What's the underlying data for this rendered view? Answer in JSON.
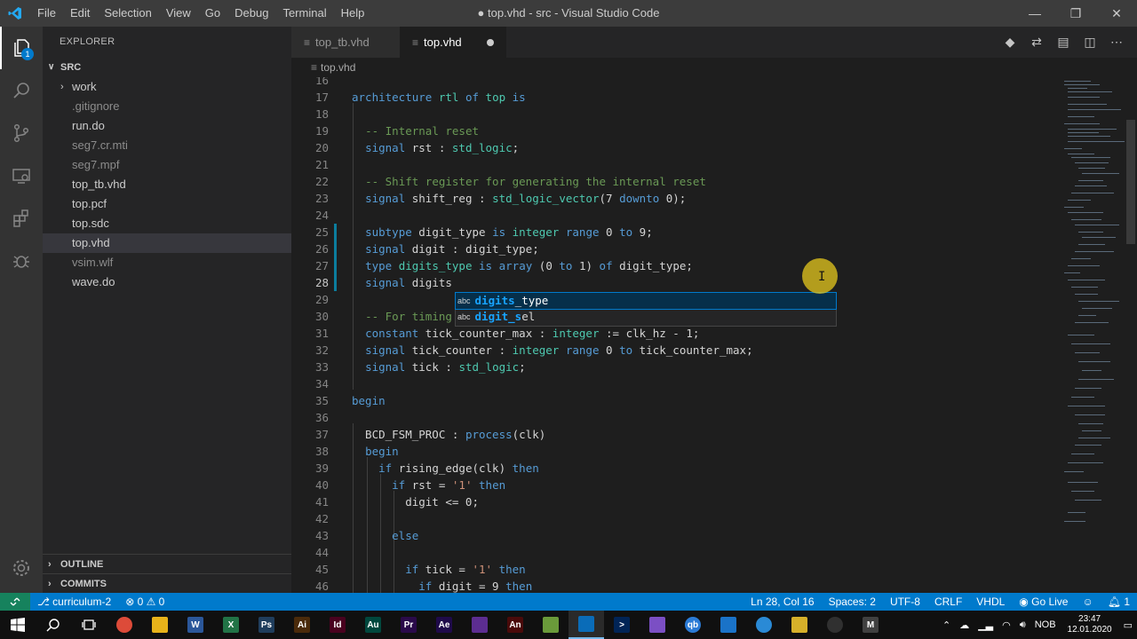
{
  "window": {
    "title": "● top.vhd - src - Visual Studio Code",
    "menu": [
      "File",
      "Edit",
      "Selection",
      "View",
      "Go",
      "Debug",
      "Terminal",
      "Help"
    ]
  },
  "activity": {
    "explorer_badge": "1"
  },
  "sidebar": {
    "title": "EXPLORER",
    "folder": "SRC",
    "items": [
      {
        "label": "work",
        "type": "folder"
      },
      {
        "label": ".gitignore",
        "type": "dim"
      },
      {
        "label": "run.do",
        "type": "file"
      },
      {
        "label": "seg7.cr.mti",
        "type": "dim"
      },
      {
        "label": "seg7.mpf",
        "type": "dim"
      },
      {
        "label": "top_tb.vhd",
        "type": "file"
      },
      {
        "label": "top.pcf",
        "type": "file"
      },
      {
        "label": "top.sdc",
        "type": "file"
      },
      {
        "label": "top.vhd",
        "type": "selected"
      },
      {
        "label": "vsim.wlf",
        "type": "dim"
      },
      {
        "label": "wave.do",
        "type": "file"
      }
    ],
    "outline": "OUTLINE",
    "commits": "COMMITS"
  },
  "tabs": [
    {
      "label": "top_tb.vhd",
      "active": false
    },
    {
      "label": "top.vhd",
      "active": true,
      "dirty": true
    }
  ],
  "breadcrumb": "top.vhd",
  "editor": {
    "lines": [
      {
        "n": "16",
        "html": ""
      },
      {
        "n": "17",
        "html": "<span class='kw'>architecture</span> <span class='ty'>rtl</span> <span class='kw'>of</span> <span class='ty'>top</span> <span class='kw'>is</span>"
      },
      {
        "n": "18",
        "html": ""
      },
      {
        "n": "19",
        "html": "  <span class='cm'>-- Internal reset</span>"
      },
      {
        "n": "20",
        "html": "  <span class='kw'>signal</span> rst : <span class='ty'>std_logic</span>;"
      },
      {
        "n": "21",
        "html": ""
      },
      {
        "n": "22",
        "html": "  <span class='cm'>-- Shift register for generating the internal reset</span>"
      },
      {
        "n": "23",
        "html": "  <span class='kw'>signal</span> shift_reg : <span class='ty'>std_logic_vector</span>(7 <span class='kw'>downto</span> 0);"
      },
      {
        "n": "24",
        "html": ""
      },
      {
        "n": "25",
        "html": "  <span class='kw'>subtype</span> digit_type <span class='kw'>is</span> <span class='ty'>integer</span> <span class='kw'>range</span> 0 <span class='kw'>to</span> 9;"
      },
      {
        "n": "26",
        "html": "  <span class='kw'>signal</span> digit : digit_type;"
      },
      {
        "n": "27",
        "html": "  <span class='kw'>type</span> <span class='ty'>digits_type</span> <span class='kw'>is</span> <span class='kw'>array</span> (0 <span class='kw'>to</span> 1) <span class='kw'>of</span> digit_type;"
      },
      {
        "n": "28",
        "html": "  <span class='kw'>signal</span> digits"
      },
      {
        "n": "29",
        "html": ""
      },
      {
        "n": "30",
        "html": "  <span class='cm'>-- For timing</span>"
      },
      {
        "n": "31",
        "html": "  <span class='kw'>constant</span> tick_counter_max : <span class='ty'>integer</span> := clk_hz - 1;"
      },
      {
        "n": "32",
        "html": "  <span class='kw'>signal</span> tick_counter : <span class='ty'>integer</span> <span class='kw'>range</span> 0 <span class='kw'>to</span> tick_counter_max;"
      },
      {
        "n": "33",
        "html": "  <span class='kw'>signal</span> tick : <span class='ty'>std_logic</span>;"
      },
      {
        "n": "34",
        "html": ""
      },
      {
        "n": "35",
        "html": "<span class='kw'>begin</span>"
      },
      {
        "n": "36",
        "html": ""
      },
      {
        "n": "37",
        "html": "  BCD_FSM_PROC : <span class='kw'>process</span>(clk)"
      },
      {
        "n": "38",
        "html": "  <span class='kw'>begin</span>"
      },
      {
        "n": "39",
        "html": "    <span class='kw'>if</span> rising_edge(clk) <span class='kw'>then</span>"
      },
      {
        "n": "40",
        "html": "      <span class='kw'>if</span> rst = <span class='st'>'1'</span> <span class='kw'>then</span>"
      },
      {
        "n": "41",
        "html": "        digit &lt;= 0;"
      },
      {
        "n": "42",
        "html": ""
      },
      {
        "n": "43",
        "html": "      <span class='kw'>else</span>"
      },
      {
        "n": "44",
        "html": ""
      },
      {
        "n": "45",
        "html": "        <span class='kw'>if</span> tick = <span class='st'>'1'</span> <span class='kw'>then</span>"
      },
      {
        "n": "46",
        "html": "          <span class='kw'>if</span> digit = 9 <span class='kw'>then</span>"
      }
    ],
    "suggestions": [
      {
        "kind": "abc",
        "match": "digits",
        "rest": "_type",
        "selected": true
      },
      {
        "kind": "abc",
        "match": "digit_s",
        "rest": "el",
        "selected": false
      }
    ]
  },
  "status": {
    "branch": "curriculum-2",
    "problems": "⊗ 0 ⚠ 0",
    "position": "Ln 28, Col 16",
    "spaces": "Spaces: 2",
    "encoding": "UTF-8",
    "eol": "CRLF",
    "language": "VHDL",
    "golive": "Go Live",
    "notifications": "1"
  },
  "taskbar": {
    "lang": "NOB",
    "time": "23:47",
    "date": "12.01.2020",
    "apps": [
      {
        "name": "chrome",
        "color": "#dd4b39",
        "text": ""
      },
      {
        "name": "explorer",
        "color": "#e8b31a",
        "text": ""
      },
      {
        "name": "word",
        "color": "#2b579a",
        "text": "W"
      },
      {
        "name": "excel",
        "color": "#217346",
        "text": "X"
      },
      {
        "name": "photoshop",
        "color": "#1f3d5c",
        "text": "Ps"
      },
      {
        "name": "illustrator",
        "color": "#4a2a0a",
        "text": "Ai"
      },
      {
        "name": "indesign",
        "color": "#49021f",
        "text": "Id"
      },
      {
        "name": "audition",
        "color": "#00473d",
        "text": "Au"
      },
      {
        "name": "premiere",
        "color": "#2a0a4a",
        "text": "Pr"
      },
      {
        "name": "aftereffects",
        "color": "#1f0a4a",
        "text": "Ae"
      },
      {
        "name": "visualstudio",
        "color": "#5c2d91",
        "text": ""
      },
      {
        "name": "animate",
        "color": "#4a0a0a",
        "text": "An"
      },
      {
        "name": "notepad",
        "color": "#6a9a3a",
        "text": ""
      },
      {
        "name": "vscode",
        "color": "#0a6cb8",
        "text": ""
      },
      {
        "name": "powershell",
        "color": "#012456",
        "text": ">"
      },
      {
        "name": "app-purple",
        "color": "#7b4fc4",
        "text": ""
      },
      {
        "name": "qbittorrent",
        "color": "#2b7bd6",
        "text": "qb"
      },
      {
        "name": "edge",
        "color": "#1a73c8",
        "text": ""
      },
      {
        "name": "app-cube",
        "color": "#2a8ad6",
        "text": ""
      },
      {
        "name": "app-yellow",
        "color": "#d6b02a",
        "text": ""
      },
      {
        "name": "obs",
        "color": "#303030",
        "text": ""
      },
      {
        "name": "app-m",
        "color": "#404040",
        "text": "M"
      }
    ]
  }
}
